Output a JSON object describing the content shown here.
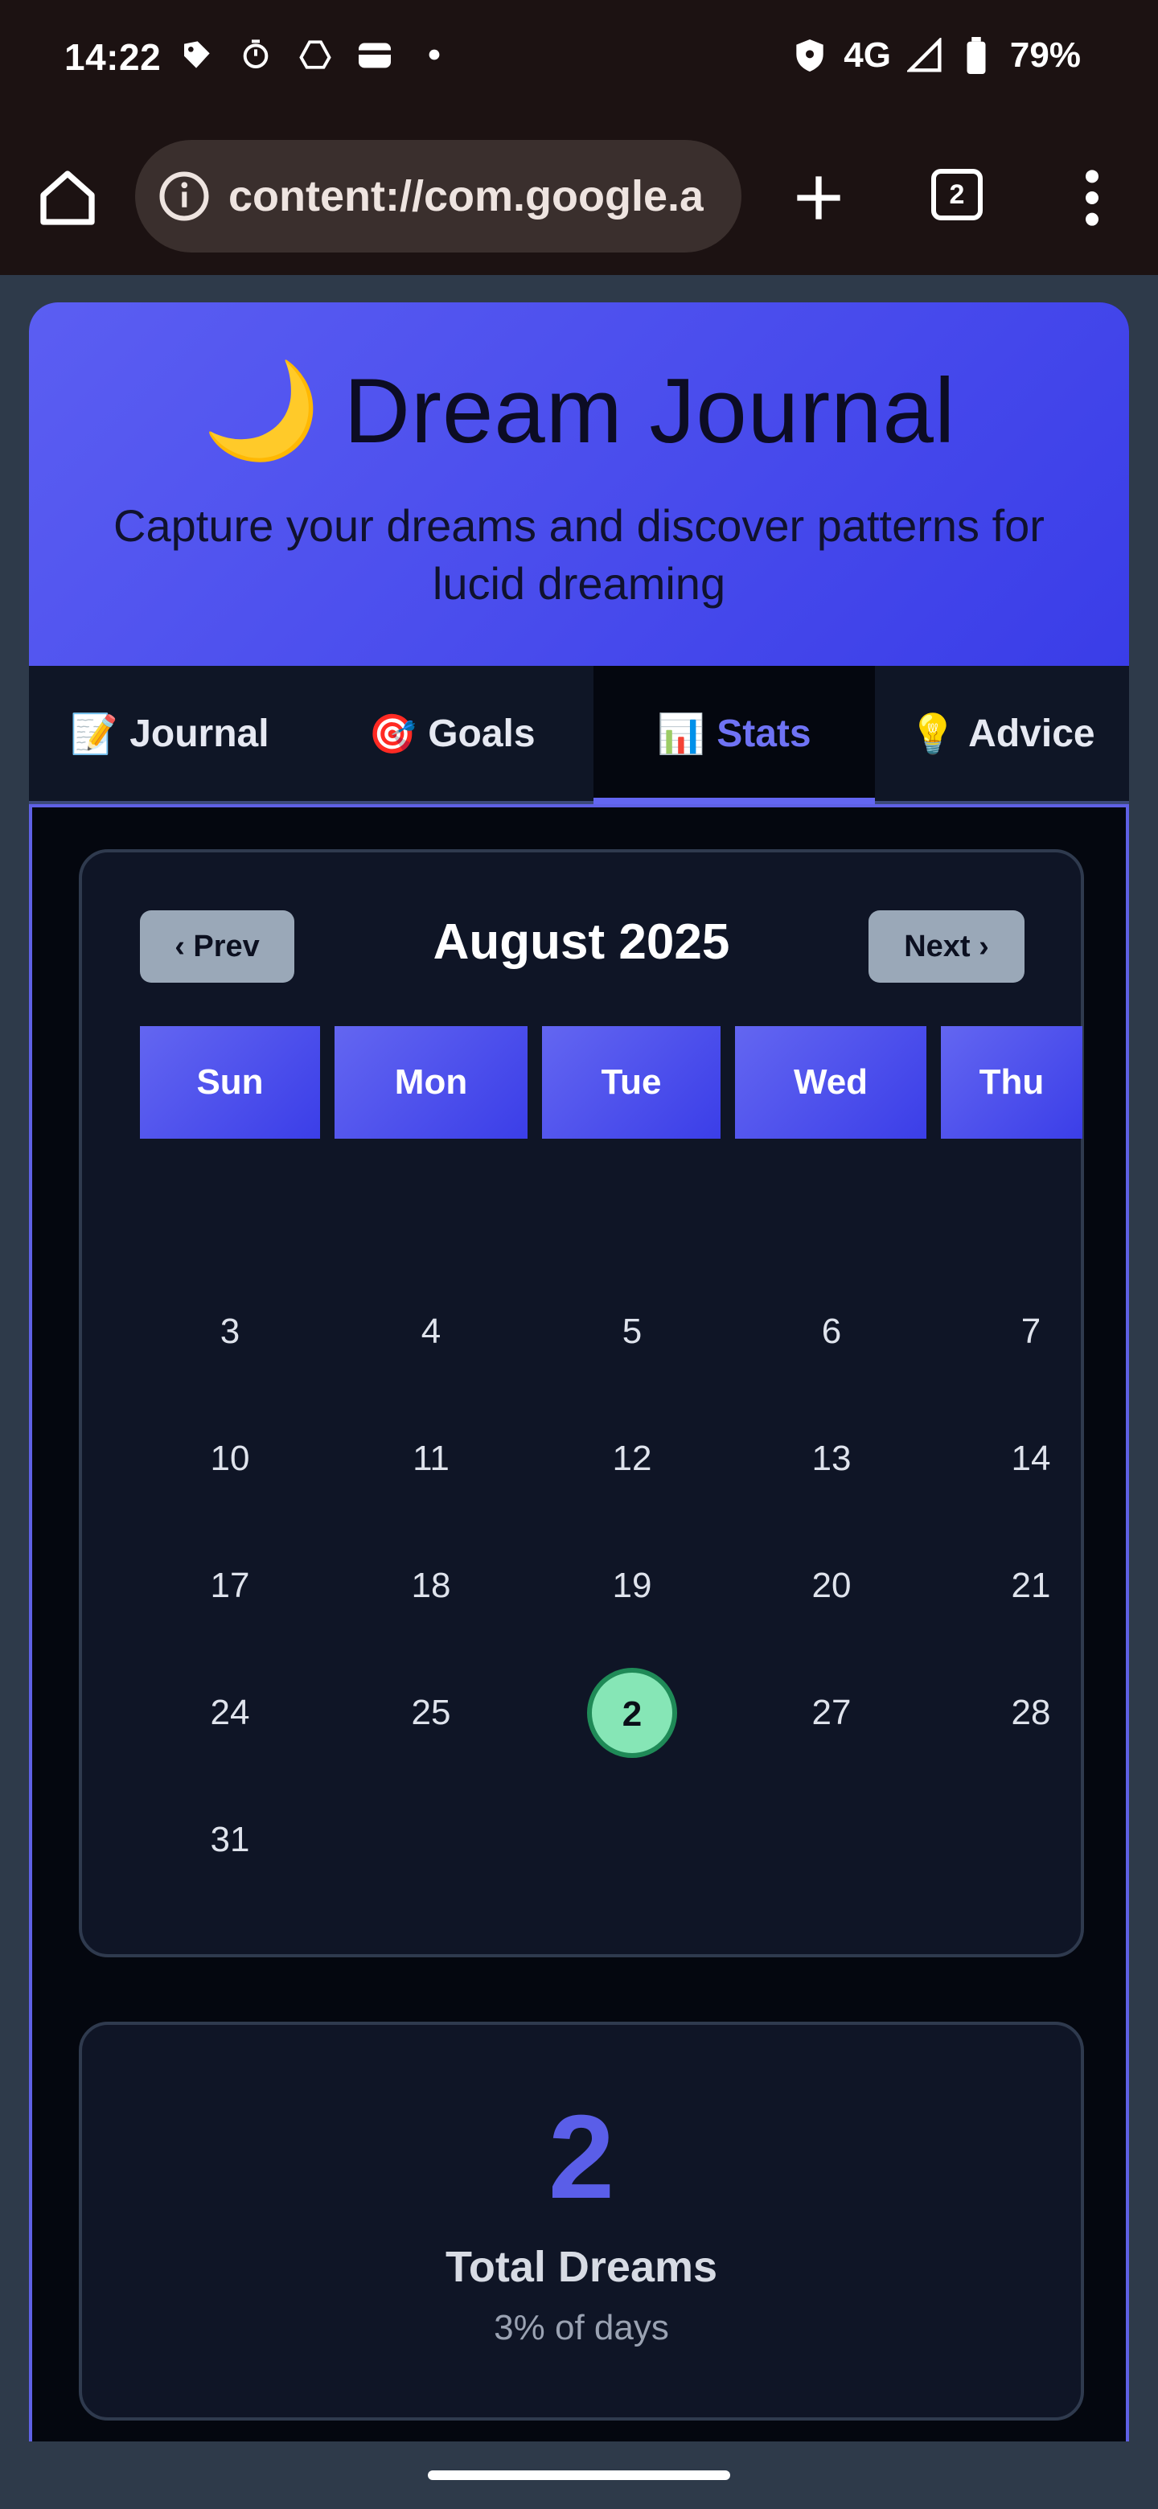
{
  "status_bar": {
    "time": "14:22",
    "network": "4G",
    "battery": "79%"
  },
  "browser": {
    "url": "content://com.google.a",
    "tab_count": "2"
  },
  "app": {
    "title": "Dream Journal",
    "title_emoji": "🌙",
    "subtitle": "Capture your dreams and discover patterns for lucid dreaming",
    "tabs": [
      {
        "emoji": "📝",
        "label": "Journal"
      },
      {
        "emoji": "🎯",
        "label": "Goals"
      },
      {
        "emoji": "📊",
        "label": "Stats",
        "active": true
      },
      {
        "emoji": "💡",
        "label": "Advice"
      }
    ]
  },
  "calendar": {
    "prev_label": "‹ Prev",
    "next_label": "Next ›",
    "month": "August 2025",
    "weekdays": [
      "Sun",
      "Mon",
      "Tue",
      "Wed",
      "Thu"
    ],
    "days": [
      [
        "3",
        "4",
        "5",
        "6",
        "7"
      ],
      [
        "10",
        "11",
        "12",
        "13",
        "14"
      ],
      [
        "17",
        "18",
        "19",
        "20",
        "21"
      ],
      [
        "24",
        "25",
        "2",
        "27",
        "28"
      ],
      [
        "31"
      ]
    ],
    "highlighted_day": "2"
  },
  "stats": {
    "total_value": "2",
    "total_label": "Total Dreams",
    "total_sub": "3% of days"
  },
  "colors": {
    "accent": "#6366f1",
    "header_gradient_start": "#5b5ef2",
    "header_gradient_end": "#3a3de8",
    "highlight_day": "#86e6b6"
  }
}
